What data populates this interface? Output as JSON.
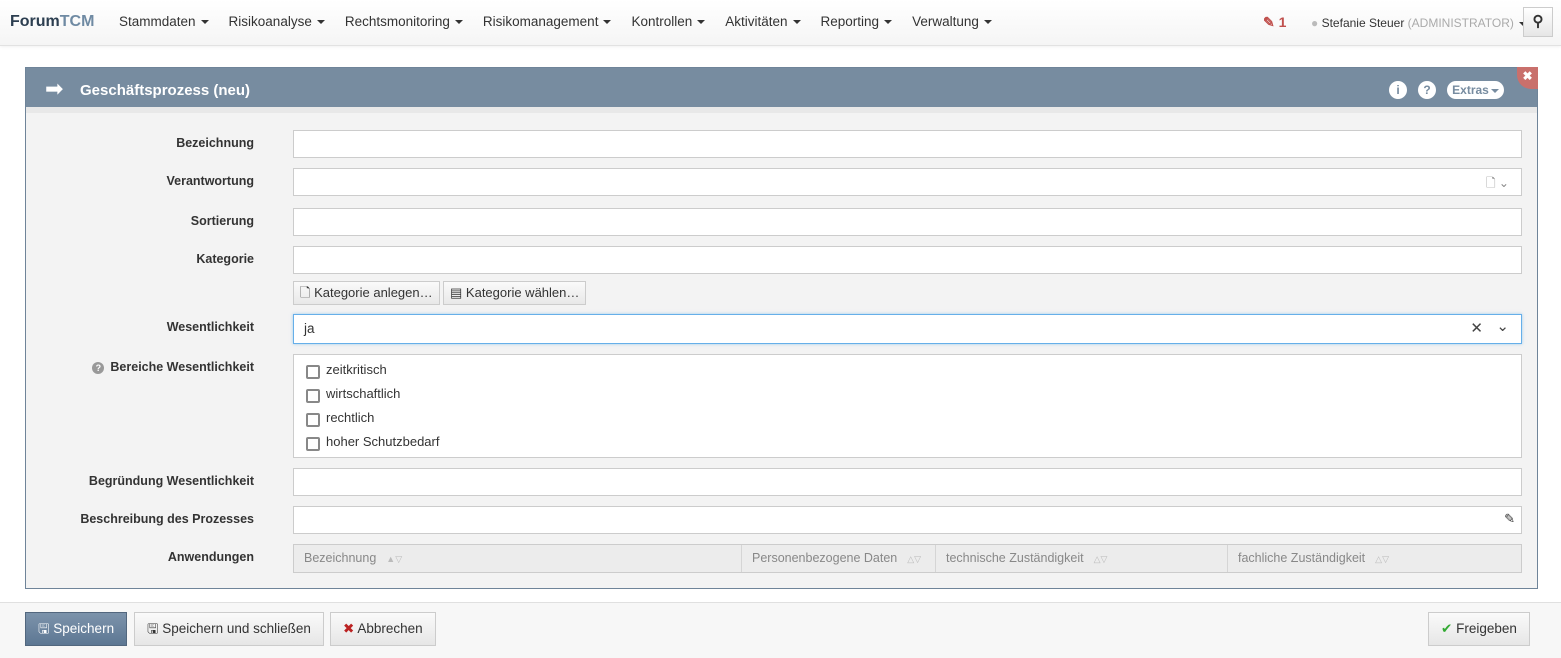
{
  "brand": {
    "part1": "Forum",
    "part2": "TCM"
  },
  "nav": {
    "items": [
      "Stammdaten",
      "Risikoanalyse",
      "Rechtsmonitoring",
      "Risikomanagement",
      "Kontrollen",
      "Aktivitäten",
      "Reporting",
      "Verwaltung"
    ],
    "notification_count": "1",
    "user_name": "Stefanie Steuer",
    "user_role": "(ADMINISTRATOR)"
  },
  "panel": {
    "title": "Geschäftsprozess (neu)",
    "extras_label": "Extras"
  },
  "form": {
    "labels": {
      "bezeichnung": "Bezeichnung",
      "verantwortung": "Verantwortung",
      "sortierung": "Sortierung",
      "kategorie": "Kategorie",
      "wesentlichkeit": "Wesentlichkeit",
      "bereiche": "Bereiche Wesentlichkeit",
      "begruendung": "Begründung Wesentlichkeit",
      "beschreibung": "Beschreibung des Prozesses",
      "anwendungen": "Anwendungen"
    },
    "kategorie_anlegen": "Kategorie anlegen…",
    "kategorie_waehlen": "Kategorie wählen…",
    "wesentlichkeit_value": "ja",
    "bereiche_options": [
      "zeitkritisch",
      "wirtschaftlich",
      "rechtlich",
      "hoher Schutzbedarf"
    ],
    "table_columns": [
      "Bezeichnung",
      "Personenbezogene Daten",
      "technische Zuständigkeit",
      "fachliche Zuständigkeit"
    ]
  },
  "footer": {
    "save": "Speichern",
    "save_close": "Speichern und schließen",
    "cancel": "Abbrechen",
    "release": "Freigeben"
  }
}
